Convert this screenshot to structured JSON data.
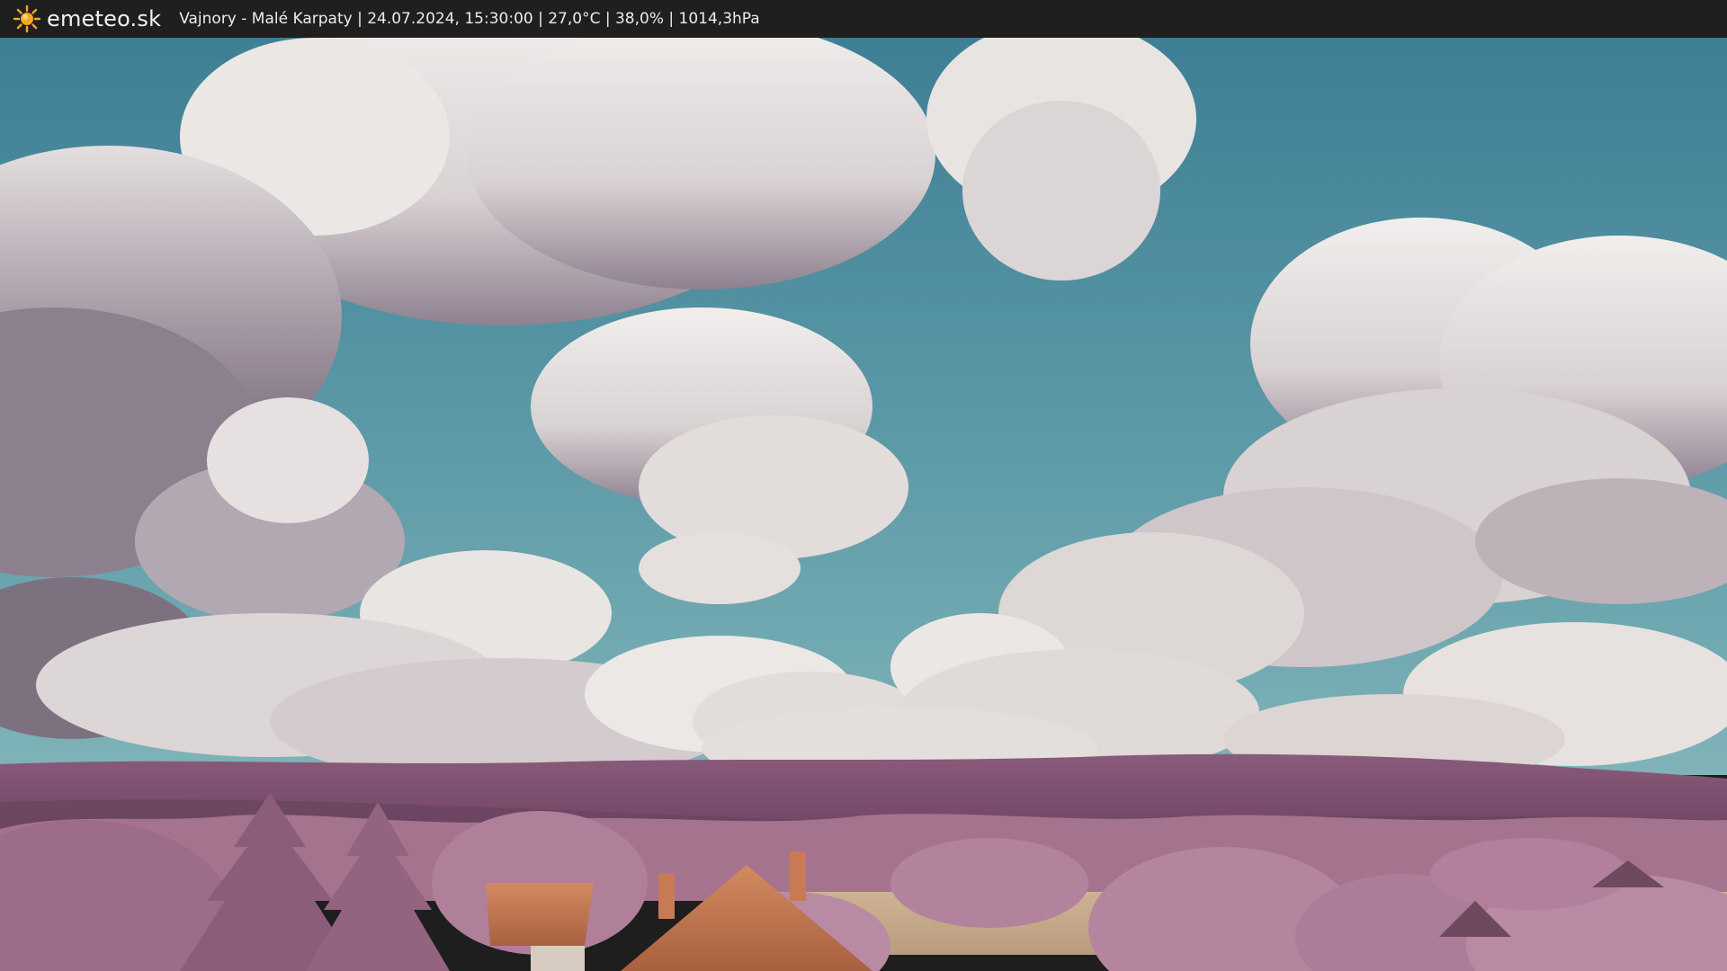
{
  "header": {
    "logo_text": "emeteo.sk",
    "logo_icon": "sun-icon",
    "info_text": "Vajnory - Malé Karpaty | 24.07.2024, 15:30:00 | 27,0°C | 38,0% | 1014,3hPa"
  },
  "colors": {
    "topbar": "#1f1f1f",
    "sun": "#f5a623",
    "sky_top": "#3f7f95",
    "sky_bottom": "#6aa7b2",
    "cloud_light": "#ece8e6",
    "cloud_shadow": "#7f7380",
    "hills": "#7a4c6a",
    "foliage": "#b7839e",
    "field": "#c8ad8c",
    "roof": "#c97b52"
  }
}
